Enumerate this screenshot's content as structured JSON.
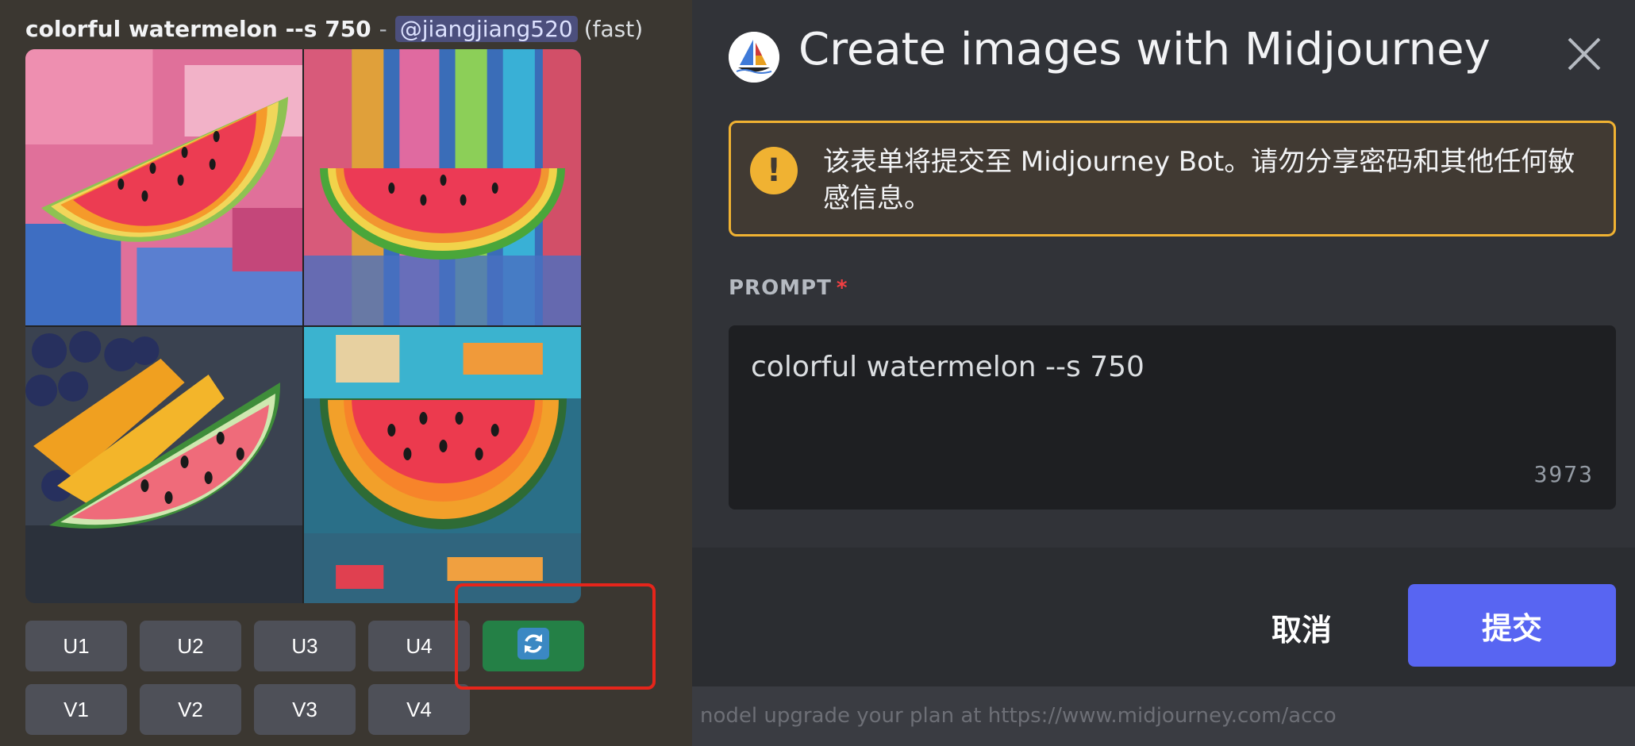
{
  "message": {
    "prompt": "colorful watermelon --s 750",
    "separator": "-",
    "mention": "@jiangjiang520",
    "speed": "(fast)"
  },
  "image_tiles": [
    {
      "description": "oil-painting watermelon slice on pink background"
    },
    {
      "description": "oil-painting watermelon half-moon on blue streaked background"
    },
    {
      "description": "photo of watermelon and yellow melon slices with blueberries"
    },
    {
      "description": "palette-knife watermelon on teal background"
    }
  ],
  "buttons": {
    "upscale": [
      "U1",
      "U2",
      "U3",
      "U4"
    ],
    "variation": [
      "V1",
      "V2",
      "V3",
      "V4"
    ],
    "reroll_icon": "refresh-icon"
  },
  "modal": {
    "title": "Create images with Midjourney",
    "warning": "该表单将提交至 Midjourney Bot。请勿分享密码和其他任何敏感信息。",
    "field_label": "PROMPT",
    "required_mark": "*",
    "prompt_value": "colorful watermelon --s 750",
    "char_count": "3973",
    "cancel_label": "取消",
    "submit_label": "提交",
    "underlay_text": "nodel upgrade your plan at https://www.midjourney.com/acco"
  },
  "colors": {
    "accent": "#5865f2",
    "reroll": "#248046",
    "warning": "#f0b232",
    "highlight": "#e5251b"
  }
}
